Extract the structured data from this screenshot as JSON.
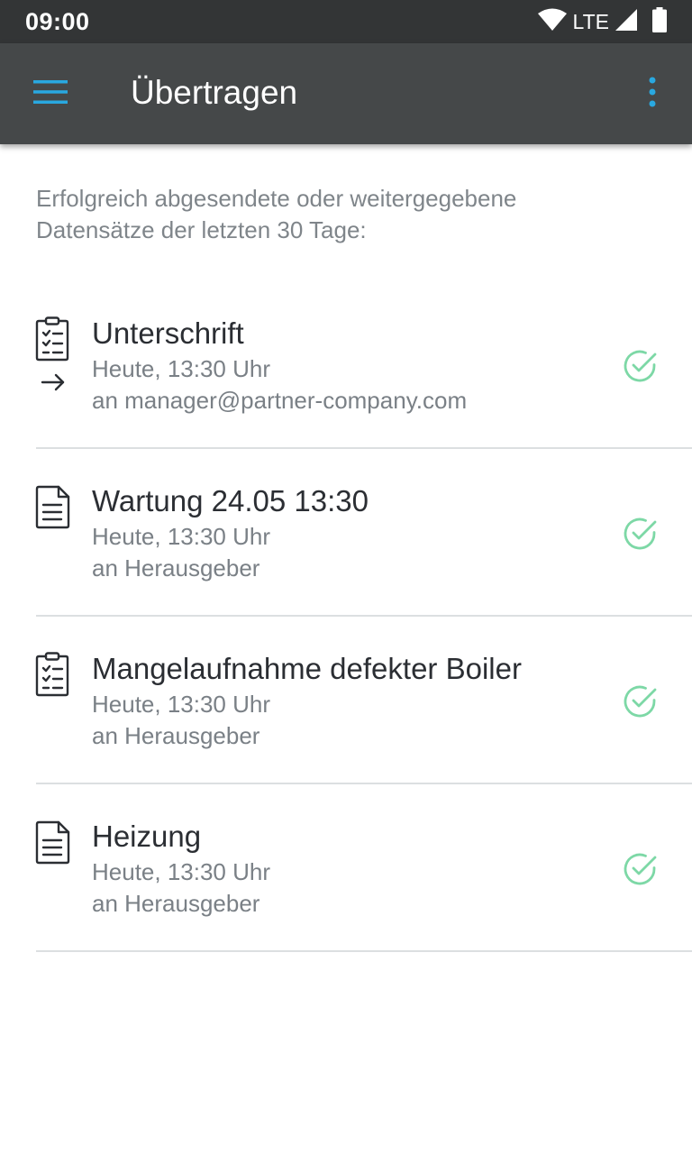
{
  "status_bar": {
    "time": "09:00",
    "network": "LTE",
    "icons": [
      "wifi-icon",
      "signal-icon",
      "battery-icon"
    ]
  },
  "app_bar": {
    "title": "Übertragen",
    "menu_icon": "hamburger-menu-icon",
    "more_icon": "more-vertical-icon",
    "accent_color": "#29a8e0"
  },
  "intro": {
    "line1": "Erfolgreich abgesendete oder weitergegebene",
    "line2": "Datensätze der letzten 30 Tage:"
  },
  "items": [
    {
      "title": "Unterschrift",
      "time": "Heute, 13:30 Uhr",
      "recipient": "an manager@partner-company.com",
      "icon": "checklist-icon",
      "forwarded": true,
      "status": "sent"
    },
    {
      "title": "Wartung 24.05 13:30",
      "time": "Heute, 13:30 Uhr",
      "recipient": "an Herausgeber",
      "icon": "document-icon",
      "forwarded": false,
      "status": "sent"
    },
    {
      "title": "Mangelaufnahme defekter Boiler",
      "time": "Heute, 13:30 Uhr",
      "recipient": "an Herausgeber",
      "icon": "checklist-icon",
      "forwarded": false,
      "status": "sent"
    },
    {
      "title": "Heizung",
      "time": "Heute, 13:30 Uhr",
      "recipient": "an Herausgeber",
      "icon": "document-icon",
      "forwarded": false,
      "status": "sent"
    }
  ],
  "colors": {
    "success": "#7dd8a6",
    "status_bar": "#333536",
    "app_bar": "#454849"
  }
}
